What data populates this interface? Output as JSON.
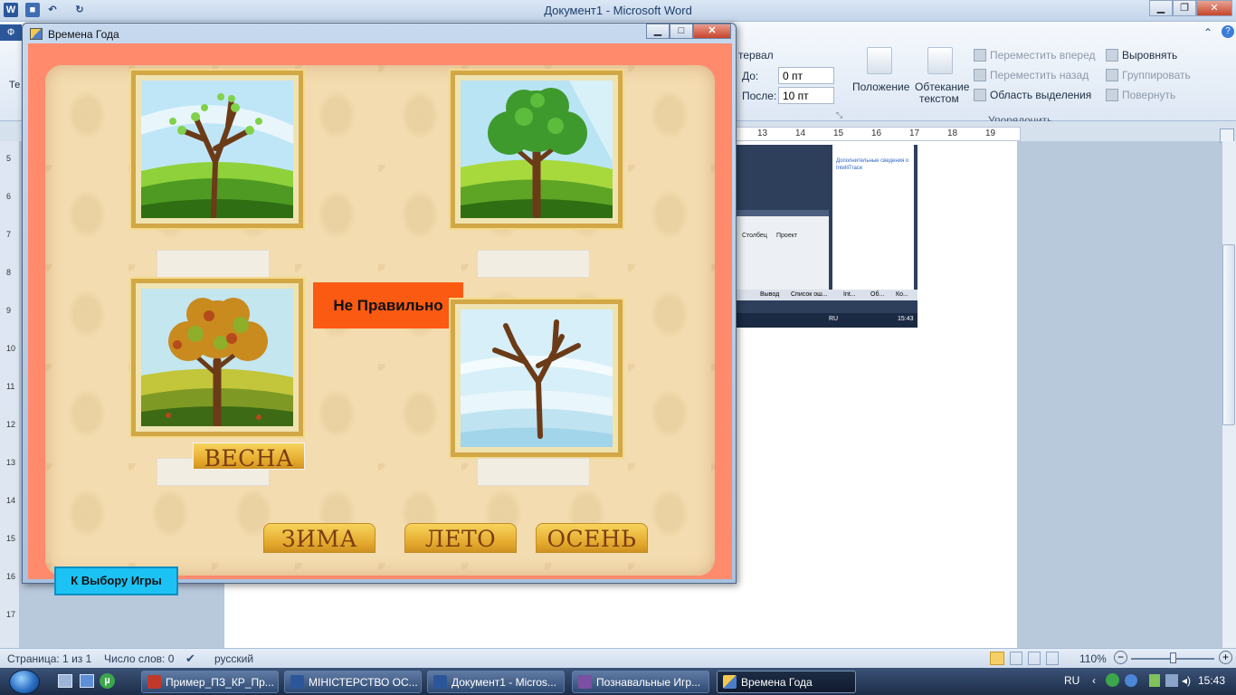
{
  "word": {
    "title": "Документ1 - Microsoft Word",
    "window_controls": {
      "minimize": "▁",
      "maximize": "❐",
      "close": "✕"
    },
    "tabs_partial": {
      "file_letter": "Ф",
      "tab2_letter": "Те"
    },
    "ribbon": {
      "interval_label": "тервал",
      "before_label": "До:",
      "before_value": "0 пт",
      "after_label": "После:",
      "after_value": "10 пт",
      "position": "Положение",
      "wrap_line1": "Обтекание",
      "wrap_line2": "текстом",
      "bring_forward": "Переместить вперед",
      "send_backward": "Переместить назад",
      "selection_pane": "Область выделения",
      "align": "Выровнять",
      "group": "Группировать",
      "rotate": "Повернуть",
      "group_label": "Упорядочить"
    },
    "ruler_numbers": [
      "13",
      "14",
      "15",
      "16",
      "17",
      "18",
      "19"
    ],
    "left_ruler_numbers": [
      "5",
      "6",
      "7",
      "8",
      "9",
      "10",
      "11",
      "12",
      "13",
      "14",
      "15",
      "16",
      "17"
    ],
    "embedded": {
      "info_text": "Дополнительные сведения о IntelliTrace",
      "col1": "Столбец",
      "col2": "Проект",
      "tab_output": "Вывод",
      "tab_errors": "Список ош...",
      "tab_int": "Int...",
      "tab_ob": "Об...",
      "tab_ko": "Ко...",
      "lang": "RU",
      "time": "15:43"
    },
    "status": {
      "page": "Страница: 1 из 1",
      "words": "Число слов: 0",
      "language": "русский",
      "zoom": "110%"
    }
  },
  "taskbar": {
    "items": [
      {
        "label": "Пример_ПЗ_КР_Пр...",
        "icon_color": "#c0392b"
      },
      {
        "label": "МІНІСТЕРСТВО ОС...",
        "icon_color": "#2b579a"
      },
      {
        "label": "Документ1 - Micros...",
        "icon_color": "#2b579a"
      },
      {
        "label": "Познавальные Игр...",
        "icon_color": "#7b4fa3"
      },
      {
        "label": "Времена Года",
        "icon_color": "#e0a030"
      }
    ],
    "lang": "RU",
    "time": "15:43"
  },
  "app": {
    "title": "Времена Года",
    "window_controls": {
      "minimize": "▁",
      "maximize": "□",
      "close": "✕"
    },
    "pictures": [
      {
        "season_depicted": "spring",
        "foliage": "#7fd24a"
      },
      {
        "season_depicted": "summer",
        "foliage": "#3e9a2c"
      },
      {
        "season_depicted": "autumn",
        "foliage": "#c98a1e"
      },
      {
        "season_depicted": "winter",
        "foliage": "none"
      }
    ],
    "dragged_word": "ВЕСНА",
    "feedback": "Не Правильно",
    "answer_buttons": [
      "ЗИМА",
      "ЛЕТО",
      "ОСЕНЬ"
    ],
    "back_button": "К Выбору Игры",
    "colors": {
      "outer_border": "#ff8a6c",
      "feedback_bg": "#fb5a12",
      "back_button_bg": "#1cc2f4",
      "word_button": "#e8b83a"
    }
  }
}
